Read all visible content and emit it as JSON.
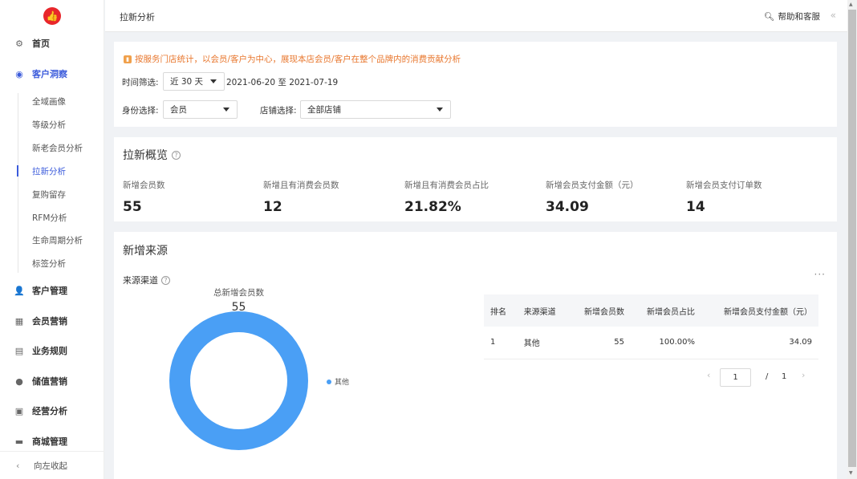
{
  "sidebar": {
    "items": [
      {
        "label": "首页",
        "icon": "dashboard-icon"
      },
      {
        "label": "客户洞察",
        "icon": "eye-icon"
      },
      {
        "label": "客户管理",
        "icon": "user-icon"
      },
      {
        "label": "会员营销",
        "icon": "gift-icon"
      },
      {
        "label": "业务规则",
        "icon": "document-icon"
      },
      {
        "label": "储值营销",
        "icon": "coin-icon"
      },
      {
        "label": "经营分析",
        "icon": "report-icon"
      },
      {
        "label": "商城管理",
        "icon": "store-icon"
      }
    ],
    "sub_items": [
      "全域画像",
      "等级分析",
      "新老会员分析",
      "拉新分析",
      "复购留存",
      "RFM分析",
      "生命周期分析",
      "标签分析"
    ],
    "collapse_label": "向左收起"
  },
  "header": {
    "title": "拉新分析",
    "help_label": "帮助和客服"
  },
  "filters": {
    "notice": "按服务门店统计，以会员/客户为中心，展现本店会员/客户在整个品牌内的消费贡献分析",
    "time_label": "时间筛选:",
    "time_value": "近 30 天",
    "date_range": "2021-06-20 至 2021-07-19",
    "identity_label": "身份选择:",
    "identity_value": "会员",
    "store_label": "店铺选择:",
    "store_value": "全部店铺"
  },
  "overview": {
    "title": "拉新概览",
    "metrics": [
      {
        "label": "新增会员数",
        "value": "55"
      },
      {
        "label": "新增且有消费会员数",
        "value": "12"
      },
      {
        "label": "新增且有消费会员占比",
        "value": "21.82%"
      },
      {
        "label": "新增会员支付金额（元）",
        "value": "34.09"
      },
      {
        "label": "新增会员支付订单数",
        "value": "14"
      }
    ]
  },
  "source": {
    "title": "新增来源",
    "subtitle": "来源渠道",
    "more": "···",
    "donut_label": "总新增会员数",
    "donut_value": "55",
    "legend": "其他",
    "colors": {
      "donut": "#4a9ff5"
    },
    "table": {
      "headers": [
        "排名",
        "来源渠道",
        "新增会员数",
        "新增会员占比",
        "新增会员支付金额（元）"
      ],
      "rows": [
        [
          "1",
          "其他",
          "55",
          "100.00%",
          "34.09"
        ]
      ]
    },
    "pager": {
      "current": "1",
      "slash": "/",
      "total": "1"
    }
  }
}
